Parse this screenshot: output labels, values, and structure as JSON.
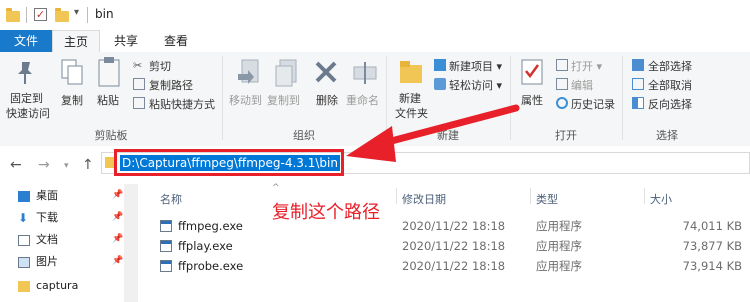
{
  "window": {
    "title": "bin"
  },
  "tabs": [
    {
      "label": "文件",
      "active": false
    },
    {
      "label": "主页",
      "active": true
    },
    {
      "label": "共享",
      "active": false
    },
    {
      "label": "查看",
      "active": false
    }
  ],
  "ribbon": {
    "clipboard": {
      "pin_label_1": "固定到",
      "pin_label_2": "快速访问",
      "copy": "复制",
      "paste": "粘贴",
      "cut": "剪切",
      "copy_path": "复制路径",
      "paste_shortcut": "粘贴快捷方式",
      "group": "剪贴板"
    },
    "organize": {
      "move_to": "移动到",
      "copy_to": "复制到",
      "delete": "删除",
      "rename": "重命名",
      "group": "组织"
    },
    "new": {
      "new_folder_1": "新建",
      "new_folder_2": "文件夹",
      "new_item": "新建项目 ▾",
      "easy_access": "轻松访问 ▾",
      "group": "新建"
    },
    "open": {
      "properties": "属性",
      "open": "打开 ▾",
      "edit": "编辑",
      "history": "历史记录",
      "group": "打开"
    },
    "select": {
      "select_all": "全部选择",
      "select_none": "全部取消",
      "invert": "反向选择",
      "group": "选择"
    }
  },
  "address": {
    "path": "D:\\Captura\\ffmpeg\\ffmpeg-4.3.1\\bin"
  },
  "nav": {
    "items": [
      {
        "label": "桌面",
        "icon": "desktop-icon"
      },
      {
        "label": "下载",
        "icon": "download-icon"
      },
      {
        "label": "文档",
        "icon": "document-icon"
      },
      {
        "label": "图片",
        "icon": "picture-icon"
      },
      {
        "label": "captura",
        "icon": "folder-icon"
      }
    ]
  },
  "columns": {
    "name": "名称",
    "modified": "修改日期",
    "type": "类型",
    "size": "大小"
  },
  "files": [
    {
      "name": "ffmpeg.exe",
      "modified": "2020/11/22 18:18",
      "type": "应用程序",
      "size": "74,011 KB"
    },
    {
      "name": "ffplay.exe",
      "modified": "2020/11/22 18:18",
      "type": "应用程序",
      "size": "73,877 KB"
    },
    {
      "name": "ffprobe.exe",
      "modified": "2020/11/22 18:18",
      "type": "应用程序",
      "size": "73,914 KB"
    }
  ],
  "annotation": {
    "text": "复制这个路径",
    "color": "#e8202a"
  },
  "colors": {
    "accent": "#1979ca",
    "selection": "#0078d7",
    "annotation": "#e8202a"
  }
}
